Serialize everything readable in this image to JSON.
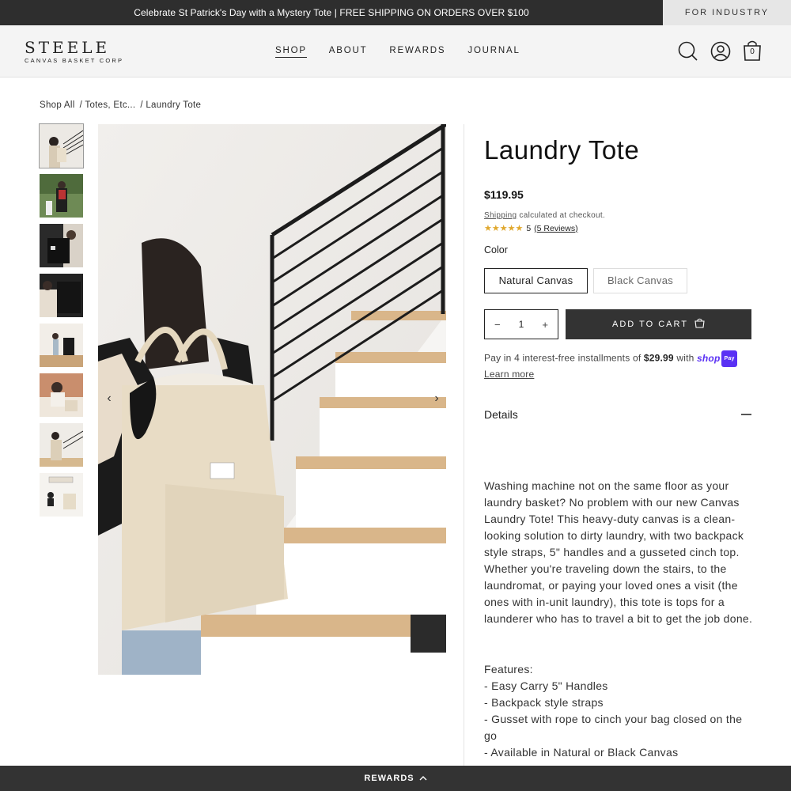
{
  "announcement": {
    "text": "Celebrate St Patrick's Day with a Mystery Tote | FREE SHIPPING ON ORDERS OVER $100",
    "industry": "FOR INDUSTRY"
  },
  "header": {
    "logo_main": "STEELE",
    "logo_sub": "CANVAS BASKET CORP",
    "nav": [
      "SHOP",
      "ABOUT",
      "REWARDS",
      "JOURNAL"
    ],
    "cart_count": "0",
    "icons": [
      "search-icon",
      "account-icon",
      "cart-icon"
    ]
  },
  "breadcrumb": [
    "Shop All",
    "/ Totes, Etc...",
    "/ Laundry Tote"
  ],
  "product": {
    "title": "Laundry Tote",
    "price": "$119.95",
    "shipping_link": "Shipping",
    "shipping_rest": " calculated at checkout.",
    "stars": "★★★★★",
    "rating": "5",
    "reviews": "(5 Reviews)",
    "color_label": "Color",
    "colors": [
      "Natural Canvas",
      "Black Canvas"
    ],
    "selected_color": "Natural Canvas",
    "qty_minus": "−",
    "qty": "1",
    "qty_plus": "+",
    "add_to_cart": "ADD TO CART",
    "pay_prefix": "Pay in 4 interest-free installments of ",
    "pay_amount": "$29.99",
    "pay_with": " with ",
    "shoppay_word": "shop",
    "shoppay_pill": "Pay",
    "learn_more": "Learn more",
    "details_label": "Details",
    "description": "Washing machine not on the same floor as your laundry basket? No problem with our new Canvas Laundry Tote! This heavy-duty canvas is a clean-looking solution to dirty laundry, with two backpack style straps, 5\" handles and a gusseted cinch top. Whether you're traveling down the stairs, to the laundromat, or paying your loved ones a visit (the ones with in-unit laundry), this tote is tops for a launderer who has to travel a bit to get the job done.",
    "features_title": "Features:",
    "features": [
      "- Easy Carry 5\" Handles",
      "- Backpack style straps",
      "- Gusset with rope to cinch your bag closed on the go",
      "- Available in Natural or Black Canvas"
    ]
  },
  "rewards_bar": "REWARDS",
  "colors": {
    "dark": "#333333",
    "star": "#e0a82e",
    "shoppay": "#5a31f4"
  }
}
